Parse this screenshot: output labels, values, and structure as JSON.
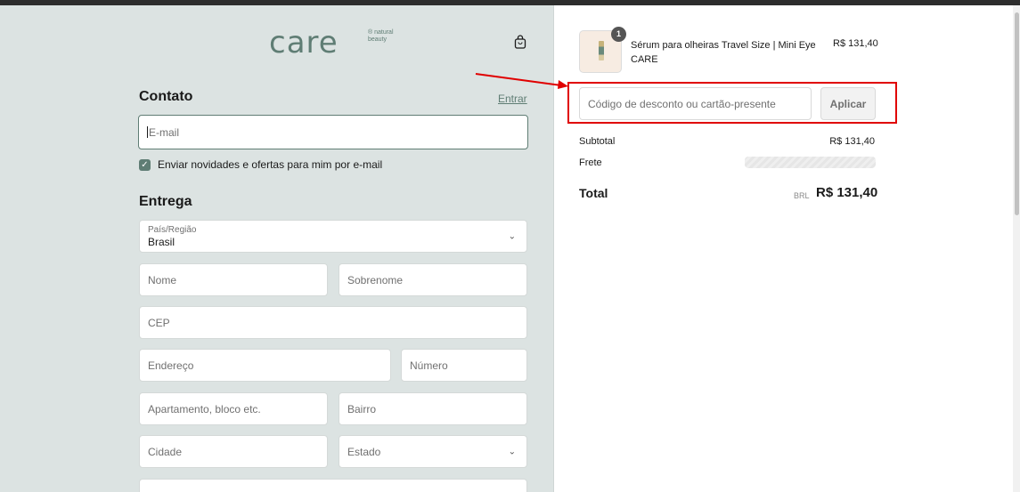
{
  "header": {
    "logo_text": "care",
    "logo_sub": "® natural beauty",
    "cart_icon": "shopping-bag-icon"
  },
  "contact": {
    "title": "Contato",
    "login_link": "Entrar",
    "email_placeholder": "E-mail",
    "newsletter_checked": true,
    "newsletter_label": "Enviar novidades e ofertas para mim por e-mail"
  },
  "delivery": {
    "title": "Entrega",
    "country_label": "País/Região",
    "country_value": "Brasil",
    "first_name": "Nome",
    "last_name": "Sobrenome",
    "zip": "CEP",
    "address": "Endereço",
    "number": "Número",
    "apartment": "Apartamento, bloco etc.",
    "neighborhood": "Bairro",
    "city": "Cidade",
    "state": "Estado"
  },
  "order": {
    "item": {
      "quantity": "1",
      "name": "Sérum para olheiras Travel Size | Mini Eye CARE",
      "price": "R$ 131,40"
    },
    "discount_placeholder": "Código de desconto ou cartão-presente",
    "apply_label": "Aplicar",
    "subtotal_label": "Subtotal",
    "subtotal_value": "R$ 131,40",
    "shipping_label": "Frete",
    "total_label": "Total",
    "total_currency": "BRL",
    "total_value": "R$ 131,40"
  },
  "colors": {
    "accent": "#5f7d74",
    "left_bg": "#dce3e2",
    "highlight": "#e00000"
  }
}
